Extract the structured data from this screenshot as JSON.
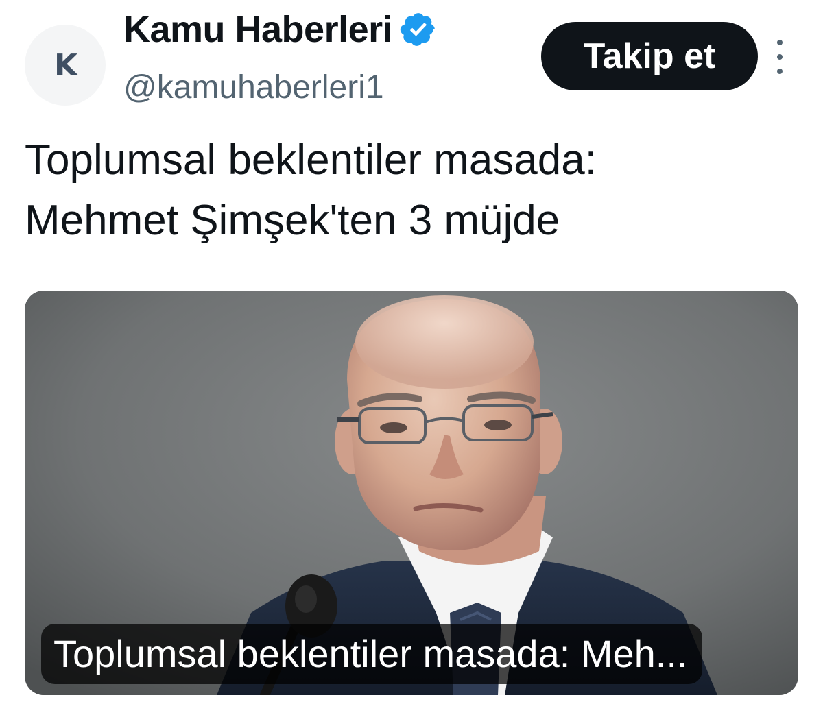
{
  "account": {
    "avatar_letter": "K",
    "display_name": "Kamu Haberleri",
    "handle": "@kamuhaberleri1",
    "verified_icon": "verified-badge-icon",
    "verified_color": "#1d9bf0"
  },
  "actions": {
    "follow_label": "Takip et",
    "more_icon": "more-vertical-icon"
  },
  "tweet": {
    "text_line1": "Toplumsal beklentiler masada:",
    "text_line2": "Mehmet Şimşek'ten 3 müjde"
  },
  "link_card": {
    "image_alt": "photo",
    "caption": "Toplumsal beklentiler masada: Meh..."
  },
  "colors": {
    "follow_button_bg": "#0f1419",
    "text_primary": "#0f1419",
    "text_secondary": "#536471"
  }
}
